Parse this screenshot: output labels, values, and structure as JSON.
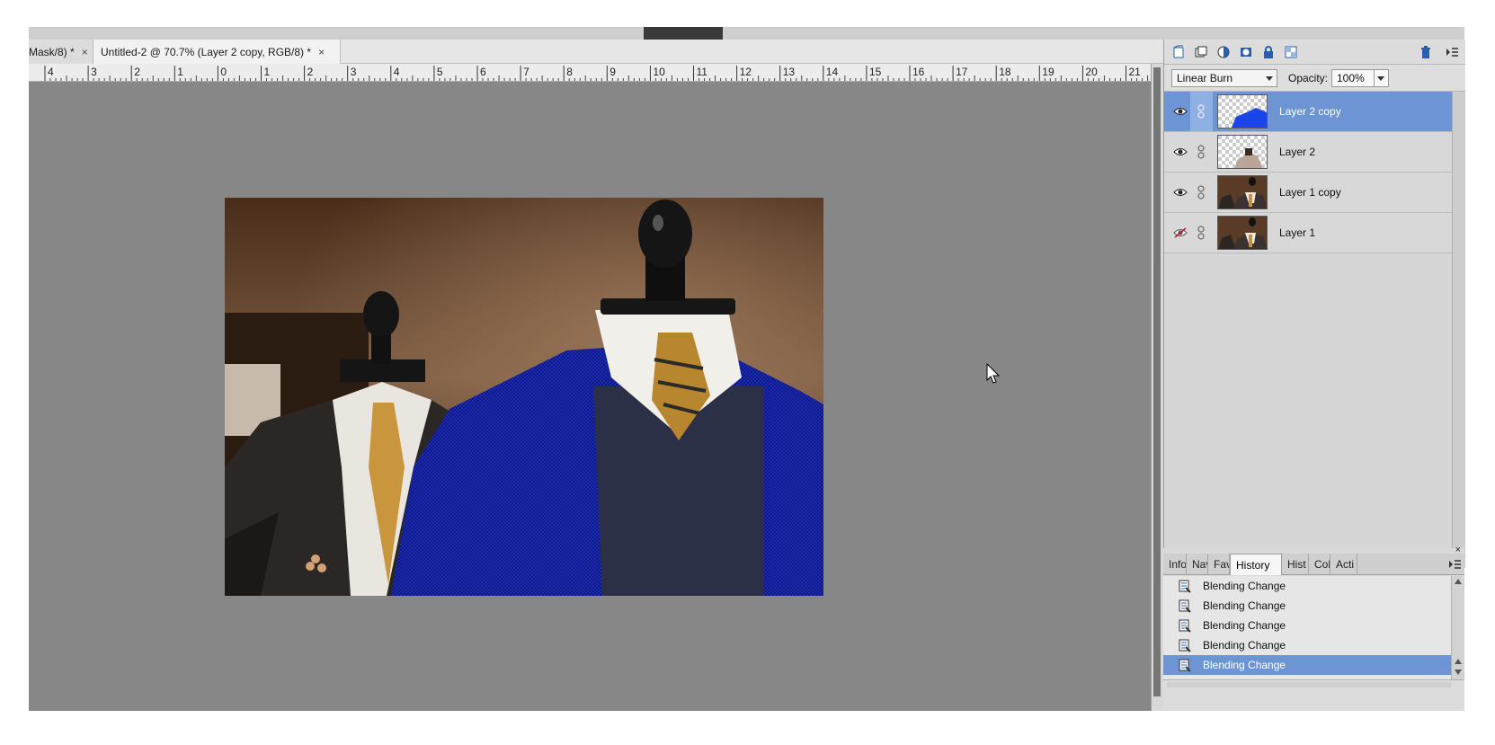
{
  "document_tabs": [
    {
      "label": "Mask/8) *",
      "close": "×"
    },
    {
      "label": "Untitled-2 @ 70.7% (Layer 2 copy, RGB/8) *",
      "close": "×"
    }
  ],
  "ruler": {
    "labels": [
      "4",
      "3",
      "2",
      "1",
      "0",
      "1",
      "2",
      "3",
      "4",
      "5",
      "6",
      "7",
      "8",
      "9",
      "10",
      "11",
      "12",
      "13",
      "14",
      "15",
      "16",
      "17",
      "18",
      "19",
      "20",
      "21"
    ]
  },
  "layers_panel": {
    "blend_mode": "Linear Burn",
    "opacity_label": "Opacity:",
    "opacity_value": "100%",
    "layers": [
      {
        "name": "Layer 2 copy",
        "visible": true,
        "selected": true
      },
      {
        "name": "Layer 2",
        "visible": true,
        "selected": false
      },
      {
        "name": "Layer 1 copy",
        "visible": true,
        "selected": false
      },
      {
        "name": "Layer 1",
        "visible": false,
        "selected": false
      }
    ]
  },
  "history_panel": {
    "close": "×",
    "tabs": [
      "Info",
      "Nav",
      "Fav",
      "History",
      "Hist",
      "Col",
      "Acti"
    ],
    "active_tab": "History",
    "items": [
      "Blending Change",
      "Blending Change",
      "Blending Change",
      "Blending Change",
      "Blending Change"
    ],
    "selected_index": 4
  },
  "colors": {
    "canvas_bg": "#878787",
    "selection": "#6d95d4",
    "panel_bg": "#d3d3d3"
  }
}
